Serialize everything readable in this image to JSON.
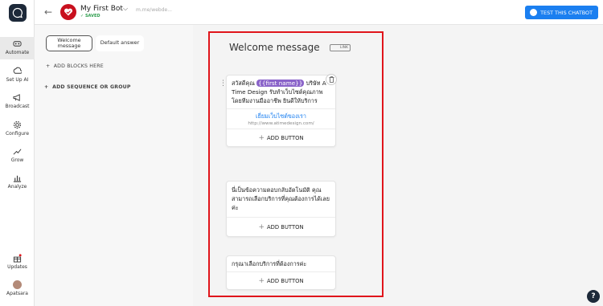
{
  "nav": {
    "items": [
      {
        "label": "Automate",
        "icon": "automate-icon"
      },
      {
        "label": "Set Up AI",
        "icon": "ai-icon"
      },
      {
        "label": "Broadcast",
        "icon": "megaphone-icon"
      },
      {
        "label": "Configure",
        "icon": "gear-icon"
      },
      {
        "label": "Grow",
        "icon": "growth-icon"
      },
      {
        "label": "Analyze",
        "icon": "chart-icon"
      }
    ],
    "updates_label": "Updates",
    "user_label": "Apatsara"
  },
  "header": {
    "bot_name": "My First Bot",
    "saved": "SAVED",
    "url": "m.me/webde...",
    "test_button": "TEST THIS CHATBOT"
  },
  "flow": {
    "tab_welcome": "Welcome message",
    "tab_default": "Default answer",
    "add_blocks": "ADD BLOCKS HERE",
    "add_sequence": "ADD SEQUENCE OR GROUP"
  },
  "canvas": {
    "title": "Welcome message",
    "link_label": "LINK",
    "card1": {
      "greet": "สวัสดีคุณ",
      "tag": "{{first name}}",
      "body": "บริษัท A Time Design รับทำเว็บไซต์คุณภาพ โดยทีมงานมืออาชีพ ยินดีให้บริการ",
      "link_title": "เยี่ยมเว็บไซต์ของเรา",
      "link_url": "http://www.atimedesign.com/",
      "add_button": "ADD BUTTON"
    },
    "card2": {
      "body": "นี่เป็นข้อความตอบกลับอัตโนมัติ คุณสามารถเลือกบริการที่คุณต้องการได้เลยค่ะ",
      "add_button": "ADD BUTTON"
    },
    "card3": {
      "body": "กรุณาเลือกบริการที่ต้องการค่ะ",
      "add_button": "ADD BUTTON"
    }
  },
  "colors": {
    "accent": "#1b7ff0",
    "highlight_box": "#e0151b",
    "tag": "#8a63c9",
    "logo": "#1d2939"
  }
}
